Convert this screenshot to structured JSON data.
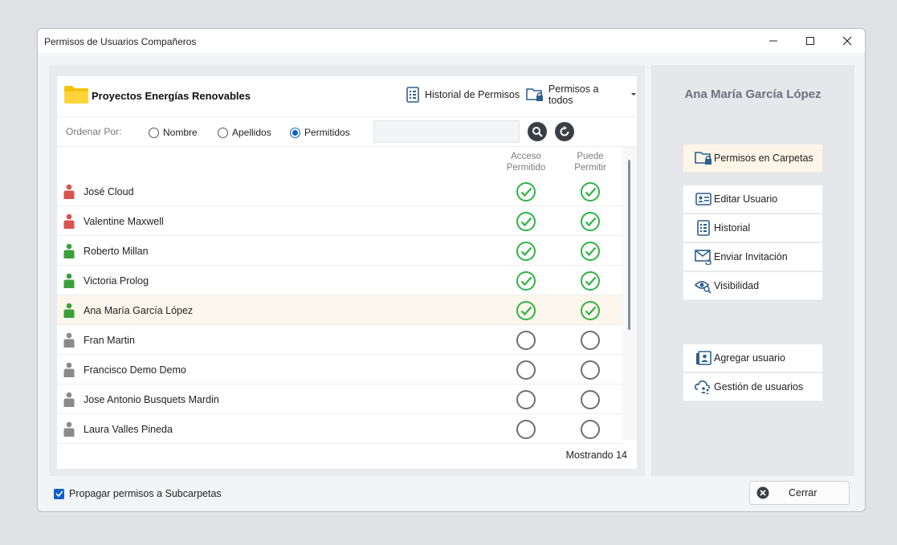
{
  "window": {
    "title": "Permisos de Usuarios Compañeros"
  },
  "folder": {
    "name": "Proyectos Energías Renovables",
    "history_label": "Historial de Permisos",
    "perm_all_label": "Permisos a todos"
  },
  "sort": {
    "label": "Ordenar Por:",
    "options": [
      {
        "label": "Nombre",
        "selected": false
      },
      {
        "label": "Apellidos",
        "selected": false
      },
      {
        "label": "Permitidos",
        "selected": true
      }
    ],
    "search_value": ""
  },
  "columns": {
    "access_line1": "Acceso",
    "access_line2": "Permitido",
    "can_line1": "Puede",
    "can_line2": "Permitir"
  },
  "users": [
    {
      "name": "José Cloud",
      "color": "#d9534f",
      "access": true,
      "can_permit": true,
      "selected": false
    },
    {
      "name": "Valentine Maxwell",
      "color": "#d9534f",
      "access": true,
      "can_permit": true,
      "selected": false
    },
    {
      "name": "Roberto Millan",
      "color": "#3aa03a",
      "access": true,
      "can_permit": true,
      "selected": false
    },
    {
      "name": "Victoria Prolog",
      "color": "#3aa03a",
      "access": true,
      "can_permit": true,
      "selected": false
    },
    {
      "name": "Ana María García López",
      "color": "#3aa03a",
      "access": true,
      "can_permit": true,
      "selected": true
    },
    {
      "name": "Fran Martin",
      "color": "#8a8a8a",
      "access": false,
      "can_permit": false,
      "selected": false
    },
    {
      "name": "Francisco Demo Demo",
      "color": "#8a8a8a",
      "access": false,
      "can_permit": false,
      "selected": false
    },
    {
      "name": "Jose Antonio Busquets Mardin",
      "color": "#8a8a8a",
      "access": false,
      "can_permit": false,
      "selected": false
    },
    {
      "name": "Laura Valles Pineda",
      "color": "#8a8a8a",
      "access": false,
      "can_permit": false,
      "selected": false
    }
  ],
  "count_label": "Mostrando 14",
  "side": {
    "user_name": "Ana María García López",
    "buttons": [
      {
        "label": "Permisos en Carpetas",
        "icon": "folder-lock-icon",
        "active": true
      },
      {
        "label": "Editar Usuario",
        "icon": "id-card-icon",
        "active": false
      },
      {
        "label": "Historial",
        "icon": "history-list-icon",
        "active": false
      },
      {
        "label": "Enviar Invitación",
        "icon": "envelope-icon",
        "active": false
      },
      {
        "label": "Visibilidad",
        "icon": "eye-search-icon",
        "active": false
      },
      {
        "label": "Agregar usuario",
        "icon": "add-user-icon",
        "active": false
      },
      {
        "label": "Gestión de usuarios",
        "icon": "cloud-users-icon",
        "active": false
      }
    ]
  },
  "footer": {
    "propagate_label": "Propagar permisos a Subcarpetas",
    "propagate_checked": true,
    "close_label": "Cerrar"
  },
  "colors": {
    "accent": "#0a62c9",
    "check_green": "#2fb344",
    "selected_row": "#fdf6ec"
  }
}
